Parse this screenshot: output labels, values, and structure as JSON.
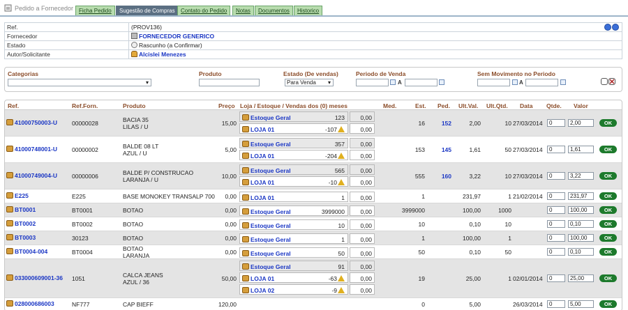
{
  "tabs": {
    "title": "Pedido a Fornecedor",
    "items": [
      "Ficha Pedido",
      "Sugestão de Compras",
      "Contato do Pedido",
      "Notas",
      "Documentos",
      "Historico"
    ]
  },
  "info": {
    "ref_label": "Ref.",
    "ref_value": "(PROV136)",
    "forn_label": "Fornecedor",
    "forn_value": "FORNECEDOR GENERICO",
    "estado_label": "Estado",
    "estado_value": "Rascunho (a Confirmar)",
    "autor_label": "Autor/Solicitante",
    "autor_value": "Alcislei Menezes"
  },
  "filters": {
    "categorias": "Categorias",
    "produto": "Produto",
    "estado": "Estado (De vendas)",
    "estado_value": "Para Venda",
    "periodo": "Periodo de Venda",
    "sem_mov": "Sem Movimento no Periodo",
    "a": "A"
  },
  "grid": {
    "headers": [
      "Ref.",
      "Ref.Forn.",
      "Produto",
      "Preço",
      "Loja / Estoque / Vendas dos (0) meses",
      "Med.",
      "Est.",
      "Ped.",
      "Ult.Val.",
      "Ult.Qtd.",
      "Data",
      "Qtde.",
      "Valor"
    ],
    "ok_label": "OK",
    "rows": [
      {
        "ref": "41000750003-U",
        "refforn": "00000028",
        "prod1": "BACIA 35",
        "prod2": "LILAS / U",
        "preco": "15,00",
        "stocks": [
          {
            "nm": "Estoque Geral",
            "v": "123",
            "med": "0,00",
            "warn": false
          },
          {
            "nm": "LOJA 01",
            "v": "-107",
            "med": "0,00",
            "warn": true
          }
        ],
        "est": "16",
        "ped": "152",
        "ultval": "2,00",
        "ultqtd": "10",
        "data": "27/03/2014",
        "qtde": "0",
        "valor": "2,00"
      },
      {
        "ref": "41000748001-U",
        "refforn": "00000002",
        "prod1": "BALDE 08 LT",
        "prod2": "AZUL / U",
        "preco": "5,00",
        "stocks": [
          {
            "nm": "Estoque Geral",
            "v": "357",
            "med": "0,00",
            "warn": false
          },
          {
            "nm": "LOJA 01",
            "v": "-204",
            "med": "0,00",
            "warn": true
          }
        ],
        "est": "153",
        "ped": "145",
        "ultval": "1,61",
        "ultqtd": "50",
        "data": "27/03/2014",
        "qtde": "0",
        "valor": "1,61"
      },
      {
        "ref": "41000749004-U",
        "refforn": "00000006",
        "prod1": "BALDE P/ CONSTRUCAO",
        "prod2": "LARANJA / U",
        "preco": "10,00",
        "stocks": [
          {
            "nm": "Estoque Geral",
            "v": "565",
            "med": "0,00",
            "warn": false
          },
          {
            "nm": "LOJA 01",
            "v": "-10",
            "med": "0,00",
            "warn": true
          }
        ],
        "est": "555",
        "ped": "160",
        "ultval": "3,22",
        "ultqtd": "10",
        "data": "27/03/2014",
        "qtde": "0",
        "valor": "3,22"
      },
      {
        "ref": "E225",
        "refforn": "E225",
        "prod1": "BASE MONOKEY TRANSALP 700",
        "prod2": "",
        "preco": "0,00",
        "stocks": [
          {
            "nm": "LOJA 01",
            "v": "1",
            "med": "0,00",
            "warn": false
          }
        ],
        "est": "1",
        "ped": "",
        "ultval": "231,97",
        "ultqtd": "1",
        "data": "21/02/2014",
        "qtde": "0",
        "valor": "231,97"
      },
      {
        "ref": "BT0001",
        "refforn": "BT0001",
        "prod1": "BOTAO",
        "prod2": "",
        "preco": "0,00",
        "stocks": [
          {
            "nm": "Estoque Geral",
            "v": "3999000",
            "med": "0,00",
            "warn": false
          }
        ],
        "est": "3999000",
        "ped": "",
        "ultval": "100,00",
        "ultqtd": "1000",
        "data": "",
        "qtde": "0",
        "valor": "100,00"
      },
      {
        "ref": "BT0002",
        "refforn": "BT0002",
        "prod1": "BOTAO",
        "prod2": "",
        "preco": "0,00",
        "stocks": [
          {
            "nm": "Estoque Geral",
            "v": "10",
            "med": "0,00",
            "warn": false
          }
        ],
        "est": "10",
        "ped": "",
        "ultval": "0,10",
        "ultqtd": "10",
        "data": "",
        "qtde": "0",
        "valor": "0,10"
      },
      {
        "ref": "BT0003",
        "refforn": "30123",
        "prod1": "BOTAO",
        "prod2": "",
        "preco": "0,00",
        "stocks": [
          {
            "nm": "Estoque Geral",
            "v": "1",
            "med": "0,00",
            "warn": false
          }
        ],
        "est": "1",
        "ped": "",
        "ultval": "100,00",
        "ultqtd": "1",
        "data": "",
        "qtde": "0",
        "valor": "100,00"
      },
      {
        "ref": "BT0004-004",
        "refforn": "BT0004",
        "prod1": "BOTAO",
        "prod2": "LARANJA",
        "preco": "0,00",
        "stocks": [
          {
            "nm": "Estoque Geral",
            "v": "50",
            "med": "0,00",
            "warn": false
          }
        ],
        "est": "50",
        "ped": "",
        "ultval": "0,10",
        "ultqtd": "50",
        "data": "",
        "qtde": "0",
        "valor": "0,10"
      },
      {
        "ref": "033000609001-36",
        "refforn": "1051",
        "prod1": "CALCA JEANS",
        "prod2": "AZUL / 36",
        "preco": "50,00",
        "stocks": [
          {
            "nm": "Estoque Geral",
            "v": "91",
            "med": "0,00",
            "warn": false
          },
          {
            "nm": "LOJA 01",
            "v": "-63",
            "med": "0,00",
            "warn": true
          },
          {
            "nm": "LOJA 02",
            "v": "-9",
            "med": "0,00",
            "warn": true
          }
        ],
        "est": "19",
        "ped": "",
        "ultval": "25,00",
        "ultqtd": "1",
        "data": "02/01/2014",
        "qtde": "0",
        "valor": "25,00"
      },
      {
        "ref": "028000686003",
        "refforn": "NF777",
        "prod1": "CAP BIEFF",
        "prod2": "",
        "preco": "120,00",
        "stocks": [],
        "est": "0",
        "ped": "",
        "ultval": "5,00",
        "ultqtd": "",
        "data": "26/03/2014",
        "qtde": "0",
        "valor": "5,00"
      }
    ]
  }
}
